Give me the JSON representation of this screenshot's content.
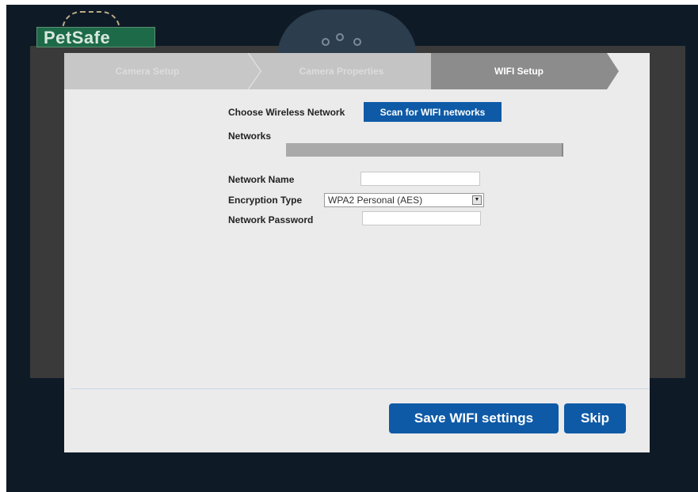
{
  "brand": {
    "logo_text": "PetSafe"
  },
  "wizard": {
    "steps": [
      {
        "label": "Camera Setup",
        "state": "inactive"
      },
      {
        "label": "Camera Properties",
        "state": "inactive"
      },
      {
        "label": "WIFI Setup",
        "state": "active"
      }
    ]
  },
  "form": {
    "choose_network_label": "Choose Wireless Network",
    "scan_button_label": "Scan for WIFI networks",
    "networks_label": "Networks",
    "network_name_label": "Network Name",
    "network_name_value": "",
    "encryption_type_label": "Encryption Type",
    "encryption_type_value": "WPA2 Personal (AES)",
    "network_password_label": "Network Password",
    "network_password_value": ""
  },
  "actions": {
    "save_label": "Save WIFI settings",
    "skip_label": "Skip"
  },
  "colors": {
    "accent_blue": "#0e5aa7",
    "step_inactive": "#c7c7c7",
    "step_active": "#8c8c8c",
    "page_background": "#0f1a27"
  }
}
